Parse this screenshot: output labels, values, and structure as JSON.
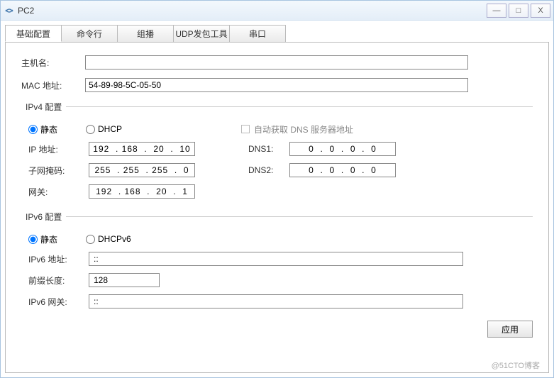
{
  "window": {
    "title": "PC2"
  },
  "tabs": {
    "basic": {
      "label": "基础配置"
    },
    "cmd": {
      "label": "命令行"
    },
    "mcast": {
      "label": "组播"
    },
    "udp": {
      "label": "UDP发包工具"
    },
    "serial": {
      "label": "串口"
    }
  },
  "basic": {
    "hostname_label": "主机名:",
    "hostname_value": "",
    "mac_label": "MAC 地址:",
    "mac_value": "54-89-98-5C-05-50"
  },
  "ipv4": {
    "legend": "IPv4 配置",
    "radio_static": "静态",
    "radio_dhcp": "DHCP",
    "auto_dns_label": "自动获取 DNS 服务器地址",
    "ip_label": "IP 地址:",
    "ip_value": "192  . 168  .  20  .  10",
    "mask_label": "子网掩码:",
    "mask_value": "255  . 255  . 255  .  0",
    "gw_label": "网关:",
    "gw_value": "192  . 168  .  20  .  1",
    "dns1_label": "DNS1:",
    "dns1_value": "0  .  0  .  0  .  0",
    "dns2_label": "DNS2:",
    "dns2_value": "0  .  0  .  0  .  0"
  },
  "ipv6": {
    "legend": "IPv6 配置",
    "radio_static": "静态",
    "radio_dhcp": "DHCPv6",
    "addr_label": "IPv6 地址:",
    "addr_value": "::",
    "prefix_label": "前缀长度:",
    "prefix_value": "128",
    "gw_label": "IPv6 网关:",
    "gw_value": "::"
  },
  "buttons": {
    "apply": "应用"
  },
  "watermark": "@51CTO博客"
}
